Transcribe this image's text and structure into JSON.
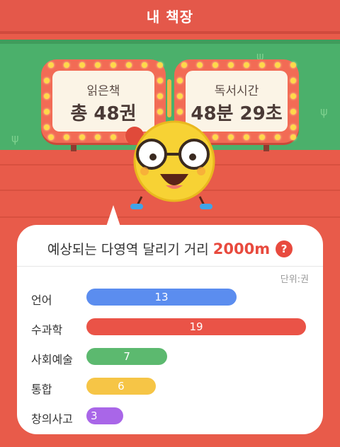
{
  "header": {
    "title": "내 책장"
  },
  "stats": {
    "books": {
      "label": "읽은책",
      "value": "총 48권"
    },
    "time": {
      "label": "독서시간",
      "value": "48분 29초"
    }
  },
  "card": {
    "title_prefix": "예상되는 다영역 달리기 거리",
    "distance": "2000m",
    "help": "?",
    "unit": "단위:권"
  },
  "chart_data": {
    "type": "bar",
    "orientation": "horizontal",
    "title": "",
    "categories": [
      "언어",
      "수과학",
      "사회예술",
      "통합",
      "창의사고"
    ],
    "values": [
      13,
      19,
      7,
      6,
      3
    ],
    "colors": [
      "#5b8def",
      "#ea5347",
      "#5cb96f",
      "#f6c546",
      "#a966e8"
    ],
    "xlim": [
      0,
      19
    ],
    "unit_label": "단위:권",
    "grid": false
  },
  "colors": {
    "accent": "#e84a3e",
    "background": "#e85b4a",
    "grass": "#4bb06b"
  }
}
